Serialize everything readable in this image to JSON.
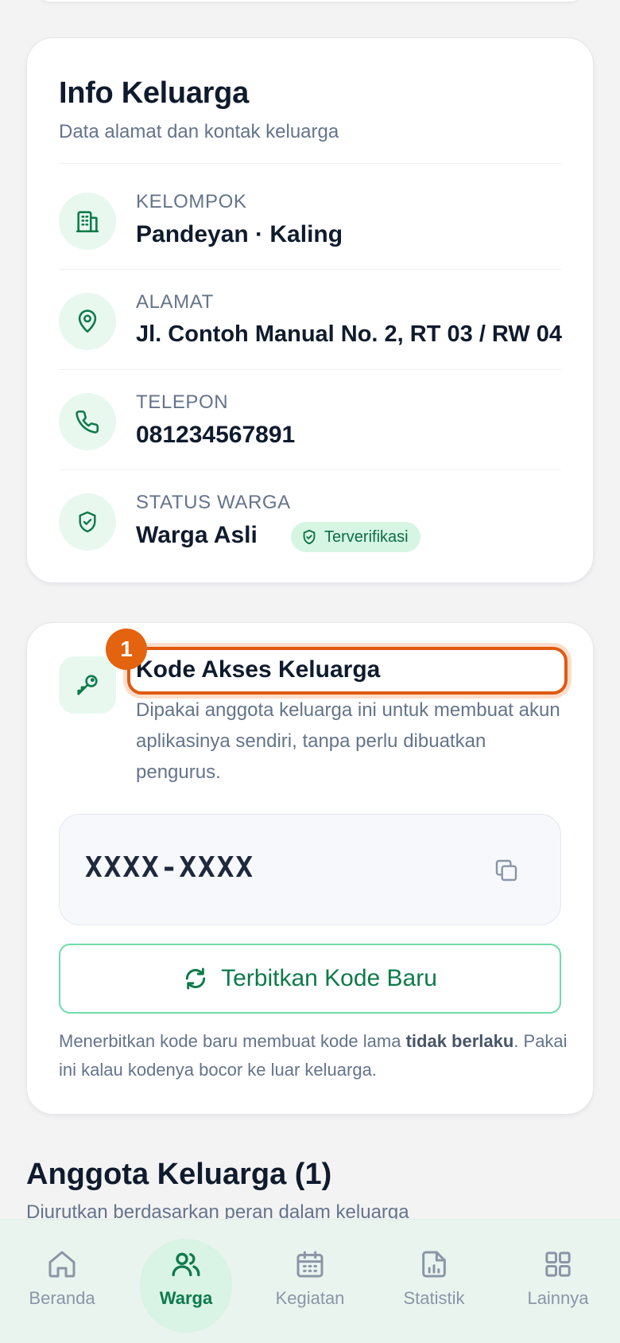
{
  "info_card": {
    "title": "Info Keluarga",
    "subtitle": "Data alamat dan kontak keluarga",
    "rows": [
      {
        "label": "KELOMPOK",
        "value": "Pandeyan · Kaling",
        "icon": "building-icon"
      },
      {
        "label": "ALAMAT",
        "value": "Jl. Contoh Manual No. 2, RT 03 / RW 04",
        "icon": "map-pin-icon"
      },
      {
        "label": "TELEPON",
        "value": "081234567891",
        "icon": "phone-icon"
      },
      {
        "label": "STATUS WARGA",
        "value": "Warga Asli",
        "icon": "shield-check-icon"
      }
    ],
    "badge": "Terverifikasi"
  },
  "kode_card": {
    "step_number": "1",
    "title": "Kode Akses Keluarga",
    "description": "Dipakai anggota keluarga ini untuk membuat akun aplikasinya sendiri, tanpa perlu dibuatkan pengurus.",
    "code": "XXXX-XXXX",
    "reissue_label": "Terbitkan Kode Baru",
    "note_pre": "Menerbitkan kode baru membuat kode lama ",
    "note_bold": "tidak berlaku",
    "note_post": ". Pakai ini kalau kodenya bocor ke luar keluarga."
  },
  "members_section": {
    "title": "Anggota Keluarga (1)",
    "subtitle": "Diurutkan berdasarkan peran dalam keluarga"
  },
  "bottom_nav": {
    "items": [
      {
        "label": "Beranda",
        "icon": "home-icon"
      },
      {
        "label": "Warga",
        "icon": "users-icon"
      },
      {
        "label": "Kegiatan",
        "icon": "calendar-icon"
      },
      {
        "label": "Statistik",
        "icon": "chart-file-icon"
      },
      {
        "label": "Lainnya",
        "icon": "grid-icon"
      }
    ],
    "active": "Warga"
  },
  "colors": {
    "accent": "#0d7a4a",
    "highlight": "#e05a10",
    "badge_bg": "#d6f5e3"
  }
}
